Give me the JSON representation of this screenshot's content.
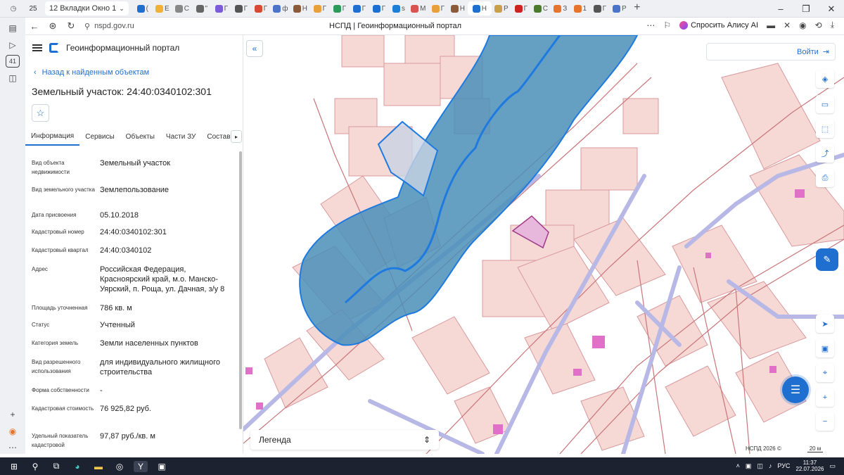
{
  "browser": {
    "tab_count": "25",
    "tab_group_label": "12 Вкладки Окно 1",
    "mini_tabs": [
      {
        "label": "(",
        "color": "#1f6fd1"
      },
      {
        "label": "Е",
        "color": "#f2b134"
      },
      {
        "label": "С",
        "color": "#888888"
      },
      {
        "label": "\"",
        "color": "#666666"
      },
      {
        "label": "Г",
        "color": "#7b5bd6"
      },
      {
        "label": "Г",
        "color": "#555555"
      },
      {
        "label": "Г",
        "color": "#d64a33"
      },
      {
        "label": "ф",
        "color": "#4a74c9"
      },
      {
        "label": "Н",
        "color": "#8a5a3a"
      },
      {
        "label": "Г",
        "color": "#e8a03a"
      },
      {
        "label": "Г",
        "color": "#2e9a5a"
      },
      {
        "label": "Г",
        "color": "#1f6fd1"
      },
      {
        "label": "Г",
        "color": "#1f6fd1"
      },
      {
        "label": "s",
        "color": "#1c7ed6"
      },
      {
        "label": "М",
        "color": "#d9534f"
      },
      {
        "label": "Г",
        "color": "#e8a03a"
      },
      {
        "label": "Н",
        "color": "#8a5a3a"
      },
      {
        "label": "Н",
        "color": "#1f6fd1"
      },
      {
        "label": "Р",
        "color": "#c9a04a"
      },
      {
        "label": "Г",
        "color": "#cc2222"
      },
      {
        "label": "С",
        "color": "#4a7a2a"
      },
      {
        "label": "З",
        "color": "#e8732a"
      },
      {
        "label": "1",
        "color": "#e8732a"
      },
      {
        "label": "Г",
        "color": "#555555"
      },
      {
        "label": "Р",
        "color": "#4a74c9"
      }
    ],
    "url": "nspd.gov.ru",
    "page_title": "НСПД | Геоинформационный портал",
    "alice_label": "Спросить Алису AI"
  },
  "portal": {
    "name": "Геоинформационный портал",
    "back_label": "Назад к найденным объектам",
    "title": "Земельный участок: 24:40:0340102:301",
    "tabs": [
      "Информация",
      "Сервисы",
      "Объекты",
      "Части ЗУ",
      "Состав"
    ],
    "active_tab": "Информация",
    "properties": [
      {
        "key": "Вид объекта недвижимости",
        "value": "Земельный участок"
      },
      {
        "key": "Вид земельного участка",
        "value": "Землепользование"
      },
      {
        "key": "Дата присвоения",
        "value": "05.10.2018"
      },
      {
        "key": "Кадастровый номер",
        "value": "24:40:0340102:301"
      },
      {
        "key": "Кадастровый квартал",
        "value": "24:40:0340102"
      },
      {
        "key": "Адрес",
        "value": "Российская Федерация, Красноярский край, м.о. Манско-Уярский, п. Роща, ул. Дачная, з/у 8"
      },
      {
        "key": "Площадь уточненная",
        "value": "786 кв. м"
      },
      {
        "key": "Статус",
        "value": "Учтенный"
      },
      {
        "key": "Категория земель",
        "value": "Земли населенных пунктов"
      },
      {
        "key": "Вид разрешенного использования",
        "value": "для индивидуального жилищного строительства"
      },
      {
        "key": "Форма собственности",
        "value": "-"
      },
      {
        "key": "Кадастровая стоимость",
        "value": "76 925,82 руб."
      },
      {
        "key": "Удельный показатель кадастровой",
        "value": "97,87 руб./кв. м"
      }
    ]
  },
  "map": {
    "login_label": "Войти",
    "legend_label": "Легенда",
    "copyright": "НСПД 2026 ©",
    "scale_label": "20 м",
    "tools": [
      "layers-icon",
      "ruler-icon",
      "select-icon",
      "share-icon",
      "print-icon",
      "locate-icon",
      "panel-icon",
      "pin-icon"
    ],
    "colors": {
      "parcel": "#f6d8d4",
      "boundary": "#c9767a",
      "water": "#4a8fb8",
      "highlight": "#e8b8dc",
      "road": "#b8b8e6"
    }
  },
  "taskbar": {
    "lang": "РУС",
    "time": "11:37",
    "date": "22.07.2026"
  }
}
